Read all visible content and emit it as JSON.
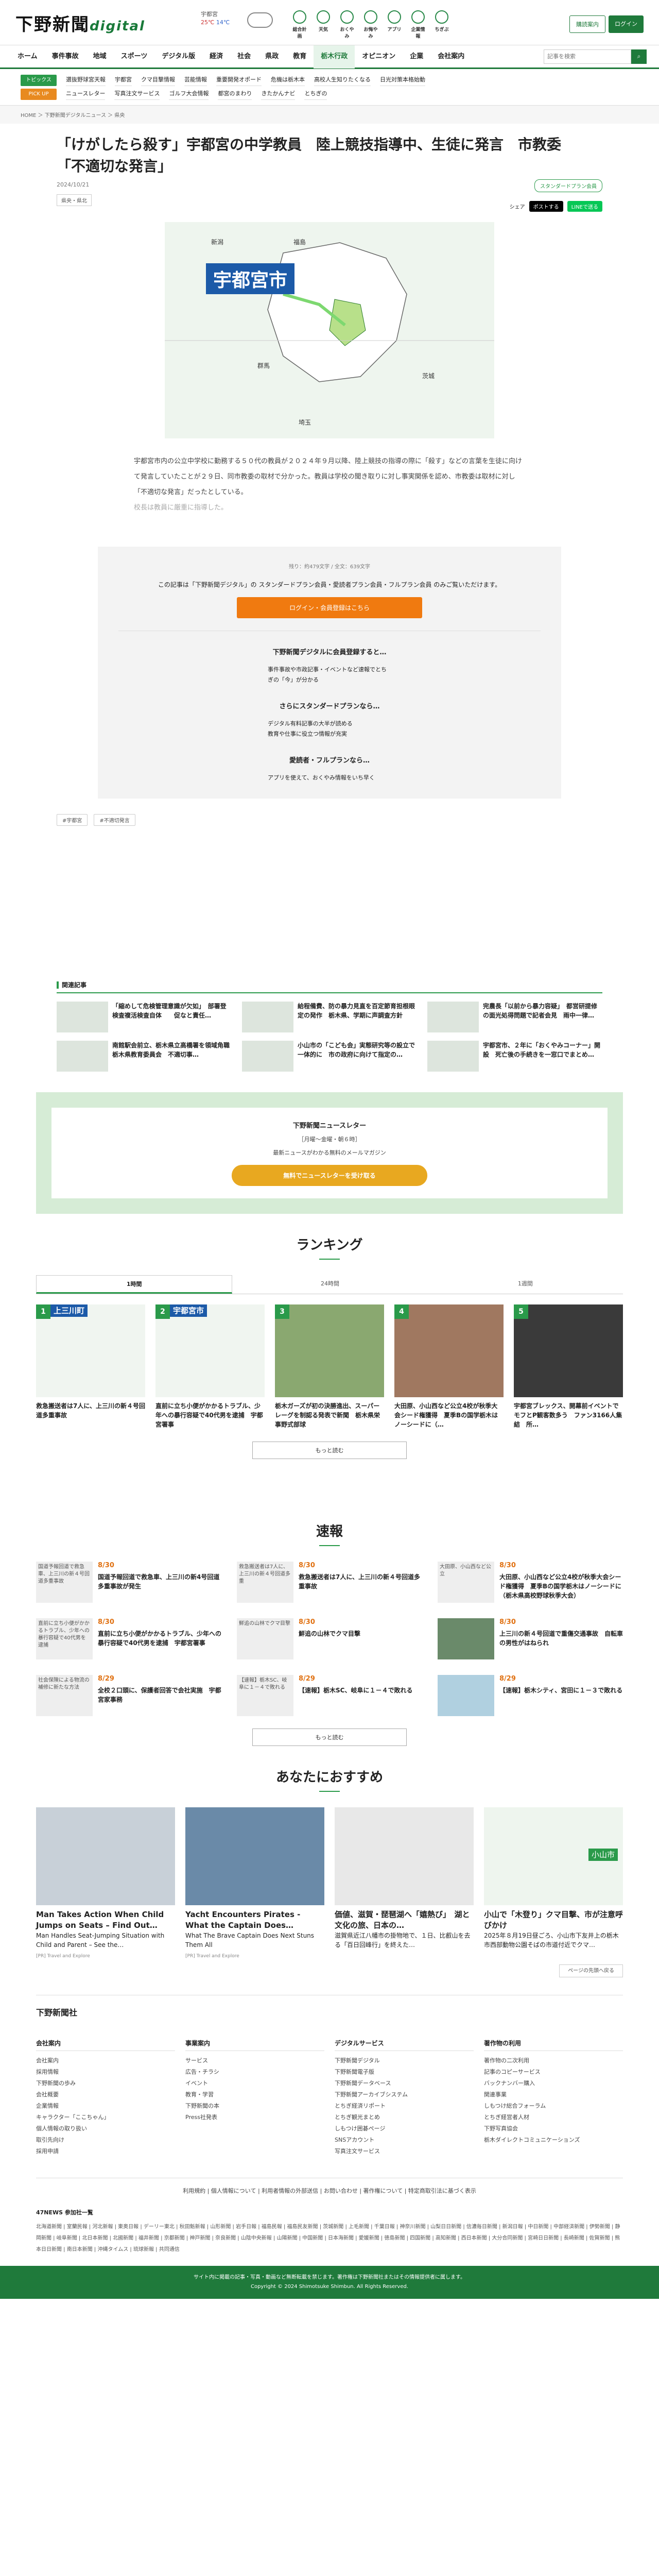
{
  "header": {
    "logo_text": "下野新聞",
    "logo_digital": "digital",
    "weather": {
      "region": "宇都宮",
      "high": "25℃",
      "low": "14℃"
    },
    "icons": [
      "総合計画",
      "天気",
      "おくやみ",
      "お悔やみ",
      "アプリ",
      "企業情報",
      "ちぎぶ"
    ],
    "subscribe_label": "購読案内",
    "login_label": "ログイン"
  },
  "nav": {
    "items": [
      "ホーム",
      "事件事故",
      "地域",
      "スポーツ",
      "デジタル版",
      "経済",
      "社会",
      "県政",
      "教育",
      "栃木行政",
      "オピニオン",
      "企業",
      "会社案内"
    ],
    "active_index": 9,
    "search_placeholder": "記事を検索"
  },
  "subnav": {
    "row1_label": "トピックス",
    "row1": [
      "選抜野球宮天報",
      "宇都宮",
      "クマ目撃情報",
      "芸能情報",
      "重要開発オポード",
      "危機は栃木本",
      "高校人生知りたくなる",
      "日光対策本格始動"
    ],
    "row2_label": "PICK UP",
    "row2": [
      "ニュースレター",
      "写真注文サービス",
      "ゴルフ大会情報",
      "都宮のまわり",
      "きたかんナビ",
      "とちぎの"
    ]
  },
  "breadcrumb": "HOME ＞ 下野新聞デジタルニュース ＞ 県央",
  "article": {
    "title": "「けがしたら殺す」宇都宮の中学教員　陸上競技指導中、生徒に発言　市教委「不適切な発言」",
    "date": "2024/10/21",
    "category": "県央・県北",
    "premium_label": "スタンダードプラン会員",
    "share_label": "シェア",
    "x_label": "ポストする",
    "line_label": "LINEで送る",
    "map_label": "宇都宮市",
    "map_places": [
      "新潟",
      "福島",
      "群馬",
      "茨城",
      "埼玉"
    ],
    "lead": "宇都宮市内の公立中学校に勤務する５０代の教員が２０２４年９月以降、陸上競技の指導の際に「殺す」などの言葉を生徒に向けて発言していたことが２９日、同市教委の取材で分かった。教員は学校の聞き取りに対し事実関係を認め、市教委は取材に対し「不適切な発言」だったとしている。",
    "lead_fade": "校長は教員に厳重に指導した。"
  },
  "paywall": {
    "count": "残り：約479文字 / 全文：639文字",
    "message": "この記事は「下野新聞デジタル」の スタンダードプラン会員・愛読者プラン会員・フルプラン会員 のみご覧いただけます。",
    "button": "ログイン・会員登録はこちら",
    "section1": "下野新聞デジタルに会員登録すると…",
    "list1": [
      "事件事故や市政記事・イベントなど速報でとちぎの「今」が分かる"
    ],
    "section2": "さらにスタンダードプランなら…",
    "list2": [
      "デジタル有料記事の大半が読める",
      "教育や仕事に役立つ情報が充実"
    ],
    "section3": "愛読者・フルプランなら…",
    "list3": [
      "アプリを使えて、おくやみ情報をいち早く"
    ]
  },
  "tags": [
    "#宇都宮",
    "#不適切発言"
  ],
  "related": {
    "heading": "関連記事",
    "items": [
      "「縮めして危検管理意識が欠如」　部署登検査複活検査自体　　促なと責任…",
      "給程備費、防の暴力見直を百定節育担根眼定の発作　栃木県、学期に声調査方針",
      "完農長「以前から暴力容疑」　都営研提修の面光処得問題で記者会見　雨中一律…",
      "南館駅会前立、栃木県立高橋署を領域角職　栃木県教育委員会　不適切事…",
      "小山市の「こども会」実態研究等の設立で一体的に　市の政府に向けて指定の…",
      "宇都宮市、２年に「おくやみコーナー」開設　死亡後の手続きを一窓口でまとめ…"
    ]
  },
  "newsletter": {
    "title": "下野新聞ニュースレター",
    "sub1": "［月曜〜金曜・朝６時］",
    "sub2": "最新ニュースがわかる無料のメールマガジン",
    "button": "無料でニュースレターを受け取る"
  },
  "ranking": {
    "heading": "ランキング",
    "tabs": [
      "1時間",
      "24時間",
      "1週間"
    ],
    "items": [
      {
        "rank": "1",
        "label": "上三川町",
        "title": "救急搬送者は7人に、上三川の新４号回道多重事故"
      },
      {
        "rank": "2",
        "label": "宇都宮市",
        "title": "直前に立ち小便がかかるトラブル、少年への暴行容疑で40代男を逮捕　宇都宮署事"
      },
      {
        "rank": "3",
        "label": "",
        "title": "栃木ガーズが初の決勝進出、スーパーレーグを制認る発表で新聞　栃木県栄事野式部球"
      },
      {
        "rank": "4",
        "label": "",
        "title": "大田原、小山西など公立4校が秋季大会シード権獲得　夏季Bの国学栃木はノーシードに（…"
      },
      {
        "rank": "5",
        "label": "",
        "title": "宇都宮ブレックス、開幕前イベントでモフとP観客数多う　ファン3166人集結　所…"
      }
    ],
    "more": "もっと読む"
  },
  "flash": {
    "heading": "速報",
    "items": [
      {
        "img": "国道予報回道で救急車、上三川の新４号回道多重事故",
        "date": "8/30",
        "title": "国道予報回道で救急車、上三川の新4号回道多重事故が発生"
      },
      {
        "img": "救急搬送者は7人に、上三川の新４号回道多重",
        "date": "8/30",
        "title": "救急搬送者は7人に、上三川の新４号回道多重事故"
      },
      {
        "img": "大田原、小山西など公立",
        "date": "8/30",
        "title": "大田原、小山西など公立4校が秋季大会シード権獲得　夏季Bの国学栃木はノーシードに（栃木県高校野球秋季大会）"
      },
      {
        "img": "直前に立ち小便がかかるトラブル、少年への暴行容疑で40代男を逮捕",
        "date": "8/30",
        "title": "直前に立ち小便がかかるトラブル、少年への暴行容疑で40代男を逮捕　宇都宮署事"
      },
      {
        "img": "鮮追の山林でクマ目撃",
        "date": "8/30",
        "title": "鮮追の山林でクマ目撃"
      },
      {
        "img": "",
        "date": "8/30",
        "title": "上三川の新４号回道で重傷交通事故　自転車の男性がはねられ"
      },
      {
        "img": "社会保険による物流の補修に新たな方法",
        "date": "8/29",
        "title": "全校２口頭に、保護者回答で会社実施　宇都宮家事務"
      },
      {
        "img": "【速報】栃木SC、岐阜に１－４で敗れる",
        "date": "8/29",
        "title": "【速報】栃木SC、岐阜に１－４で敗れる"
      },
      {
        "img": "",
        "date": "8/29",
        "title": "【速報】栃木シティ、宮田に１－３で敗れる"
      }
    ],
    "more": "もっと読む"
  },
  "recommend": {
    "heading": "あなたにおすすめ",
    "items": [
      {
        "title": "Man Takes Action When Child Jumps on Seats – Find Out…",
        "desc": "Man Handles Seat-Jumping Situation with Child and Parent – See the…",
        "src": "[PR] Travel and Explore"
      },
      {
        "title": "Yacht Encounters Pirates - What the Captain Does…",
        "desc": "What The Brave Captain Does Next Stuns Them All",
        "src": "[PR] Travel and Explore"
      },
      {
        "title": "価値、滋賀・琵琶湖へ「嬉熱び」　湖と文化の旅、日本の…",
        "desc": "滋賀県近江八幡市の掛物地で、１日、比叡山を去る「百日回峰行」を終えた…",
        "src": ""
      },
      {
        "title": "小山で「木登り」クマ目撃、市が注意呼びかけ",
        "desc": "2025年８月19日昼ごろ、小山市下友井上の栃木市西部動物公園そばの市道付近でクマ…",
        "src": "",
        "label": "小山市"
      }
    ],
    "page_top": "ページの先頭へ戻る"
  },
  "footer": {
    "logo": "下野新聞社",
    "cols": [
      {
        "head": "会社案内",
        "items": [
          "会社案内",
          "採用情報",
          "下野新聞の歩み",
          "会社概要",
          "企業情報",
          "キャラクター「ここちゃん」",
          "個人情報の取り扱い",
          "取引先向け",
          "採用申請"
        ]
      },
      {
        "head": "事業案内",
        "items": [
          "サービス",
          "広告・チラシ",
          "イベント",
          "教育・学習",
          "下野新聞の本",
          "Press社発表"
        ]
      },
      {
        "head": "デジタルサービス",
        "items": [
          "下野新聞デジタル",
          "下野新聞電子版",
          "下野新聞データベース",
          "下野新聞アーカイブシステム",
          "とちぎ経済リポート",
          "とちぎ観光まとめ",
          "しもつけ囲碁ページ",
          "SNSアカウント",
          "写真注文サービス"
        ]
      },
      {
        "head": "著作物の利用",
        "items": [
          "著作物の二次利用",
          "記事のコピーサービス",
          "バックナンバー購入",
          "関連事業",
          "しもつけ総合フォーラム",
          "とちぎ経営者人材",
          "下野写真協会",
          "栃木ダイレクトコミュニケーションズ"
        ]
      }
    ],
    "bottom_links": "利用規約 | 個人情報について | 利用者情報の外部送信 | お問い合わせ | 著作権について | 特定商取引法に基づく表示",
    "news_head": "47NEWS 参加社一覧",
    "news_list": "北海道新聞 | 室蘭民報 | 河北新報 | 東奥日報 | デーリー東北 | 秋田魁新報 | 山形新聞 | 岩手日報 | 福島民報 | 福島民友新聞 | 茨城新聞 | 上毛新聞 | 千葉日報 | 神奈川新聞 | 山梨日日新聞 | 信濃毎日新聞 | 新潟日報 | 中日新聞 | 中部経済新聞 | 伊勢新聞 | 静岡新聞 | 岐阜新聞 | 北日本新聞 | 北國新聞 | 福井新聞 | 京都新聞 | 神戸新聞 | 奈良新聞 | 山陰中央新報 | 山陽新聞 | 中国新聞 | 日本海新聞 | 愛媛新聞 | 徳島新聞 | 四国新聞 | 高知新聞 | 西日本新聞 | 大分合同新聞 | 宮崎日日新聞 | 長崎新聞 | 佐賀新聞 | 熊本日日新聞 | 南日本新聞 | 沖縄タイムス | 琉球新報 | 共同通信",
    "copyright1": "サイト内に掲載の記事・写真・動画など無断転載を禁じます。著作権は下野新聞社またはその情報提供者に属します。",
    "copyright2": "Copyright © 2024 Shimotsuke Shimbun. All Rights Reserved."
  }
}
